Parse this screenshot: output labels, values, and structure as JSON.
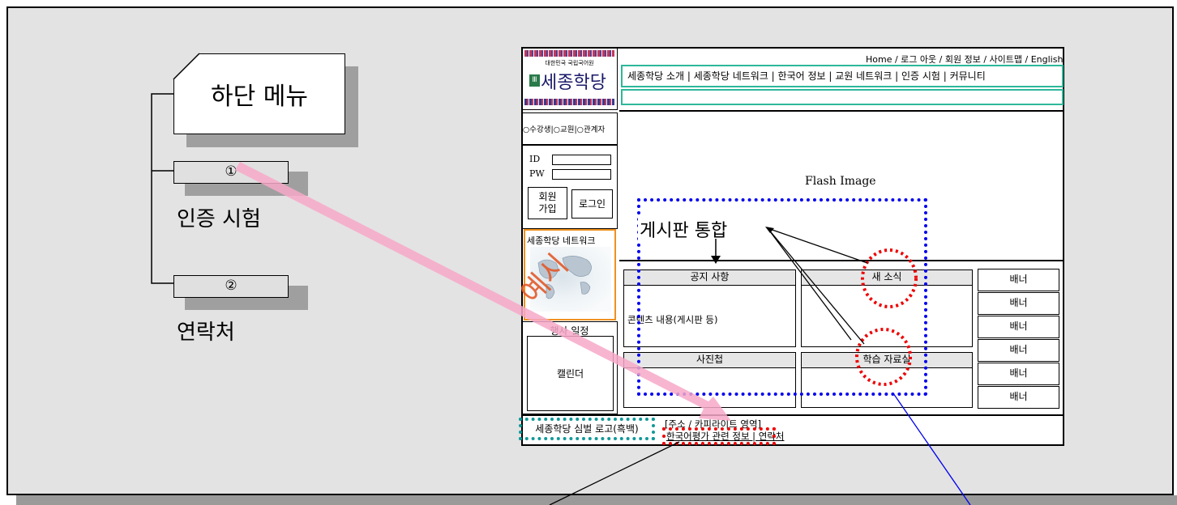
{
  "left_panel": {
    "main_label": "하단 메뉴",
    "items": [
      {
        "number": "①",
        "label": "인증 시험"
      },
      {
        "number": "②",
        "label": "연락처"
      }
    ]
  },
  "mockup": {
    "logo": {
      "subtitle": "대한민국 국립국어원",
      "name": "세종학당"
    },
    "top_links": "Home / 로그 아웃 / 회원 정보 / 사이트맵 / English",
    "nav": "세종학당 소개 | 세종학당 네트워크 | 한국어 정보 | 교원 네트워크 | 인증 시험 | 커뮤니티",
    "user_type": "○수강생|○교원|○관계자",
    "login": {
      "id_label": "ID",
      "pw_label": "PW",
      "join": "회원 가입",
      "login": "로그인"
    },
    "network_box": "세종학당 네트워크",
    "example_stamp": "예시",
    "flash": "Flash Image",
    "board_merge": "게시판 통합",
    "boards": {
      "notice": "공지 사항",
      "news": "새 소식",
      "content": "콘텐츠 내용(게시판 등)",
      "photo": "사진첩",
      "study": "학습 자료실"
    },
    "banners": [
      "배너",
      "배너",
      "배너",
      "배너",
      "배너",
      "배너"
    ],
    "event": {
      "title": "행사 일정",
      "calendar": "캘린더"
    },
    "footer": {
      "logo_text": "세종학당 심벌 로고(흑백)",
      "address": "[주소 / 카피라이트 영역]",
      "links": "한국어평가 관련 정보 | 연락처"
    }
  },
  "colors": {
    "canvas": "#e3e3e3",
    "arrow": "#f7a8c8",
    "highlight_blue": "#0000ee",
    "highlight_red": "#ee0000",
    "nav_border": "#2db89a",
    "network_border": "#f0911e",
    "stamp": "#e35a2a",
    "logo_teal": "#119999"
  }
}
